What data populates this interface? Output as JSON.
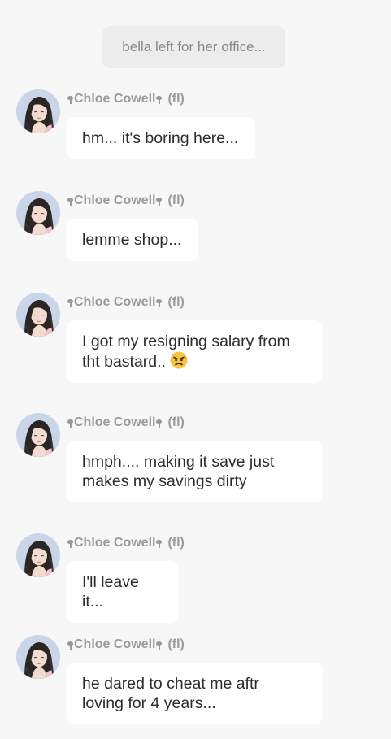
{
  "system_note": "bella left for her office...",
  "sender_name": "Chloe Cowell",
  "sender_tag": "(fl)",
  "messages": [
    {
      "text": "hm... it's boring here..."
    },
    {
      "text": "lemme shop..."
    },
    {
      "text": "I got my resigning salary from\ntht bastard.. ",
      "emoji": "angry-face"
    },
    {
      "text": "hmph.... making it save just\nmakes my savings dirty"
    },
    {
      "text": "I'll leave it..."
    },
    {
      "text": "he dared to cheat me aftr\nloving for 4 years..."
    }
  ],
  "colors": {
    "background": "#f7f7f7",
    "bubble": "#ffffff",
    "system_bubble": "#ececec",
    "sender_text": "#9a9a9a"
  }
}
